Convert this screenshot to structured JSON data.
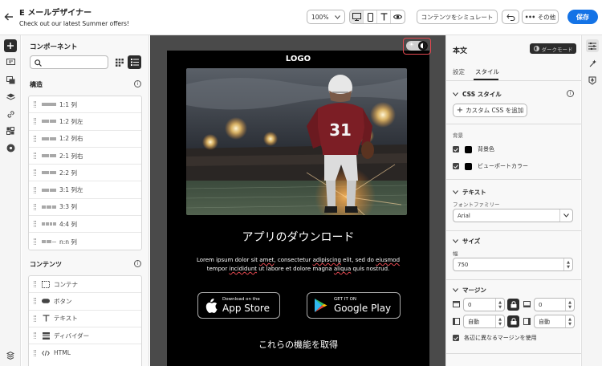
{
  "header": {
    "title": "E メールデザイナー",
    "subtitle": "Check out our latest Summer offers!",
    "zoom": "100%",
    "simulate_label": "コンテンツをシミュレート",
    "more_label": "その他",
    "save_label": "保存"
  },
  "components_panel": {
    "title": "コンポーネント",
    "search_placeholder": "",
    "structure_title": "構造",
    "structure_items": [
      {
        "label": "1:1 列",
        "cols": 1
      },
      {
        "label": "1:2 列左",
        "cols": 2
      },
      {
        "label": "1:2 列右",
        "cols": 2
      },
      {
        "label": "2:1 列右",
        "cols": 2
      },
      {
        "label": "2:2 列",
        "cols": 2
      },
      {
        "label": "3:1 列左",
        "cols": 2
      },
      {
        "label": "3:3 列",
        "cols": 3
      },
      {
        "label": "4:4 列",
        "cols": 4
      },
      {
        "label": "n:n 列",
        "cols": 0
      }
    ],
    "contents_title": "コンテンツ",
    "content_items": [
      {
        "label": "コンテナ",
        "icon": "container-icon"
      },
      {
        "label": "ボタン",
        "icon": "button-icon"
      },
      {
        "label": "テキスト",
        "icon": "text-icon"
      },
      {
        "label": "ディバイダー",
        "icon": "divider-icon"
      },
      {
        "label": "HTML",
        "icon": "html-icon"
      }
    ]
  },
  "email": {
    "logo": "LOGO",
    "hero_jersey_number": "31",
    "download_title": "アプリのダウンロード",
    "body_text": "Lorem ipsum dolor sit amet, consectetur adipiscing elit, sed do eiusmod tempor incididunt ut labore et dolore magna aliqua quis nostrud.",
    "app_store_small": "Download on the",
    "app_store_big": "App Store",
    "google_play_small": "GET IT ON",
    "google_play_big": "Google Play",
    "features_title": "これらの機能を取得"
  },
  "properties": {
    "title": "本文",
    "darkmode_badge": "ダークモード",
    "tabs": [
      "設定",
      "スタイル"
    ],
    "active_tab": "スタイル",
    "css_section": "CSS スタイル",
    "add_css_label": "カスタム CSS を追加",
    "background_label": "背景",
    "bg_color_label": "背景色",
    "viewport_color_label": "ビューポートカラー",
    "text_section": "テキスト",
    "font_family_label": "フォントファミリー",
    "font_family_value": "Arial",
    "size_section": "サイズ",
    "width_label": "幅",
    "width_value": "750",
    "margin_section": "マージン",
    "margin_top": "0",
    "margin_bottom": "0",
    "margin_left": "自動",
    "margin_right": "自動",
    "different_margins_label": "各辺に異なるマージンを使用"
  },
  "colors": {
    "accent": "#1473e6",
    "highlight": "#e34850",
    "canvas": "#4a4a4a"
  }
}
